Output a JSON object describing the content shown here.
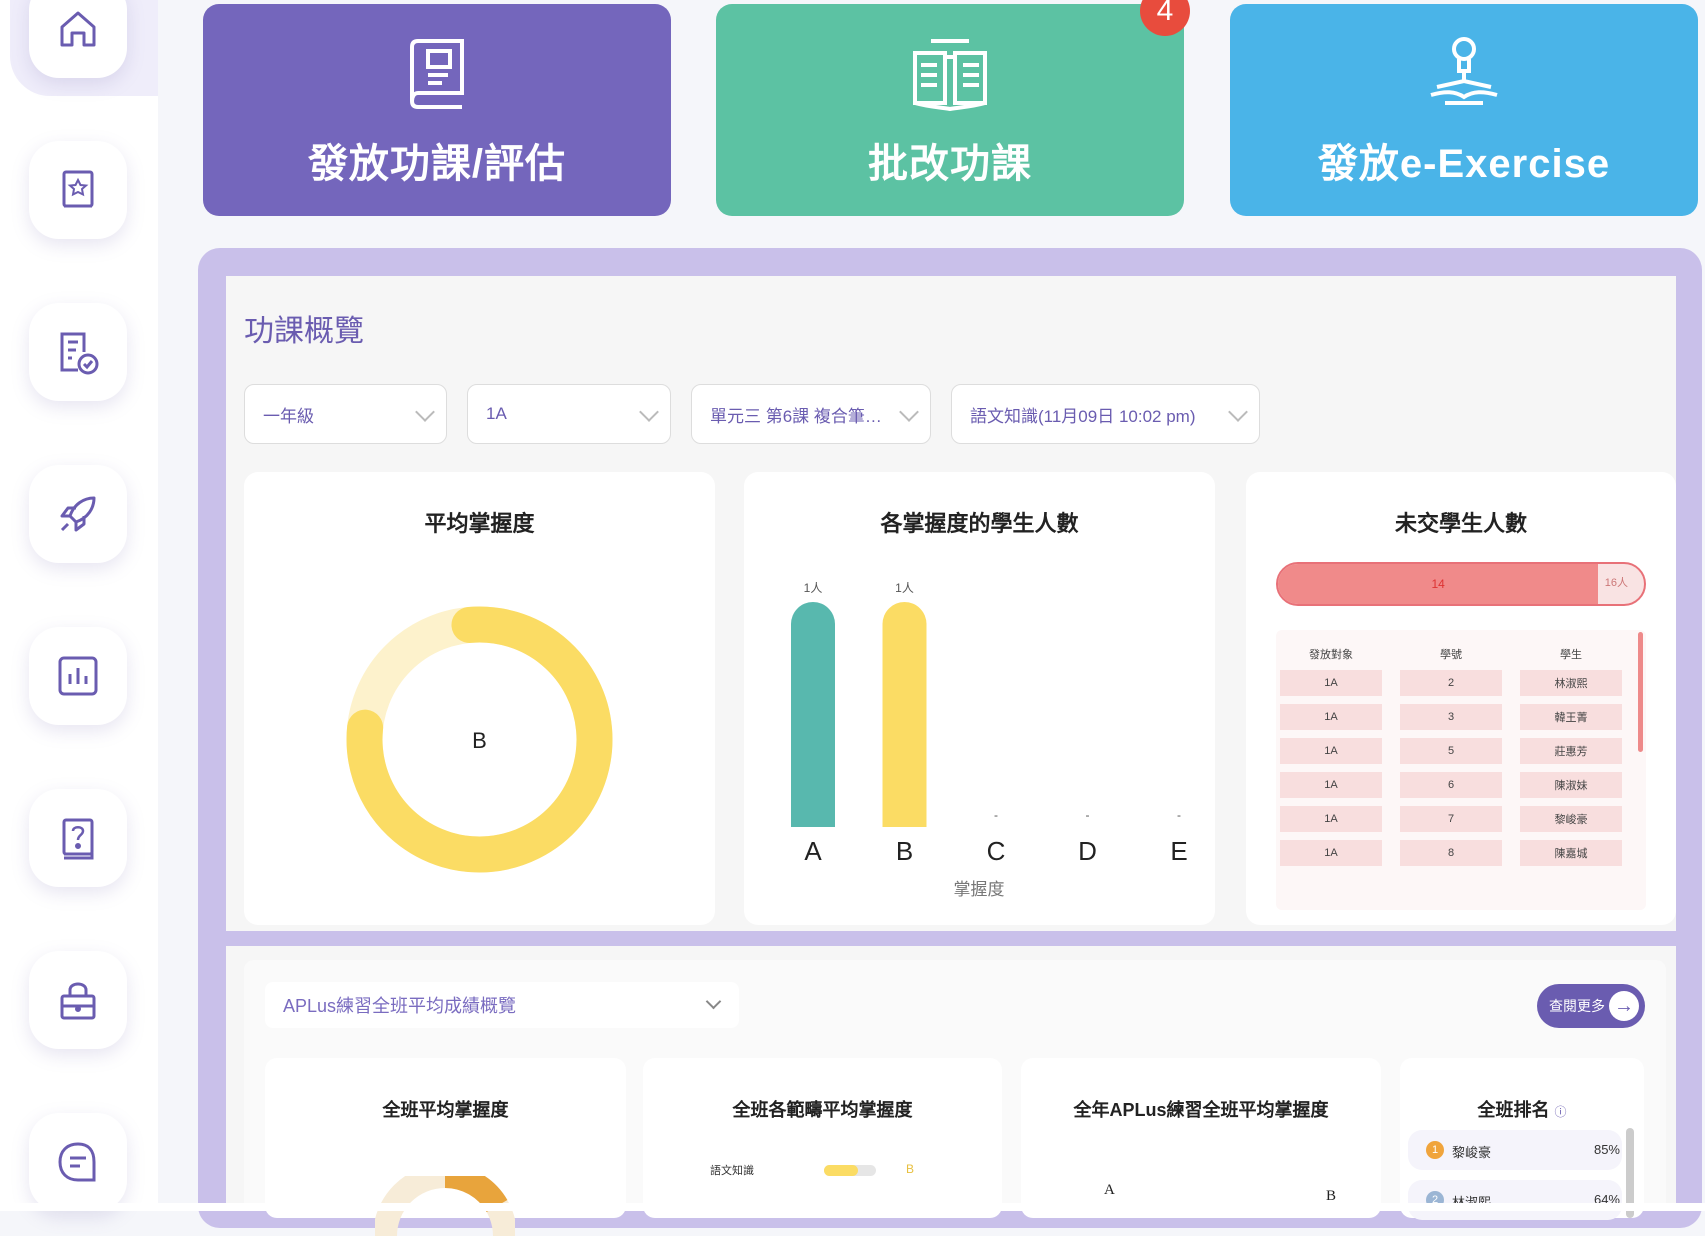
{
  "action_buttons": [
    {
      "label": "發放功課/評估",
      "color": "#7466bc",
      "icon": "notebook-icon"
    },
    {
      "label": "批改功課",
      "color": "#5cc2a3",
      "icon": "open-book-icon",
      "badge": "4"
    },
    {
      "label": "發放e-Exercise",
      "color": "#4ab4e8",
      "icon": "reading-lightbulb-icon"
    }
  ],
  "sidebar": {
    "items": [
      "home-icon",
      "star-book-icon",
      "checklist-icon",
      "rocket-icon",
      "bar-chart-icon",
      "question-book-icon",
      "lock-bag-icon",
      "chat-icon"
    ]
  },
  "overview": {
    "title": "功課概覽",
    "filters": {
      "grade": "一年級",
      "class": "1A",
      "unit": "單元三 第6課 複合筆…",
      "assignment": "語文知識(11月09日 10:02 pm)"
    }
  },
  "avg_mastery": {
    "title": "平均掌握度",
    "center_label": "B",
    "ring_fraction": 0.78,
    "ring_color": "#fbdc64",
    "track_color": "#fdf2cc"
  },
  "chart_data": {
    "type": "bar",
    "title": "各掌握度的學生人數",
    "categories": [
      "A",
      "B",
      "C",
      "D",
      "E"
    ],
    "values": [
      1,
      1,
      0,
      0,
      0
    ],
    "data_labels": [
      "1人",
      "1人",
      "-",
      "-",
      "-"
    ],
    "bar_colors": [
      "#58b8ae",
      "#fbdc64",
      "#cccccc",
      "#cccccc",
      "#cccccc"
    ],
    "xlabel": "掌握度",
    "ylabel": ""
  },
  "not_submitted": {
    "title": "未交學生人數",
    "count": "14",
    "total_label": "16人",
    "count_value": 14,
    "total_value": 16,
    "columns": [
      "發放對象",
      "學號",
      "學生"
    ],
    "rows": [
      [
        "1A",
        "2",
        "林淑熙"
      ],
      [
        "1A",
        "3",
        "韓王菁"
      ],
      [
        "1A",
        "5",
        "莊惠芳"
      ],
      [
        "1A",
        "6",
        "陳淑妹"
      ],
      [
        "1A",
        "7",
        "黎峻豪"
      ],
      [
        "1A",
        "8",
        "陳嘉城"
      ]
    ]
  },
  "aplus": {
    "selector": "APLus練習全班平均成績概覽",
    "more_button": "查閱更多",
    "cards": [
      {
        "title": "全班平均掌握度"
      },
      {
        "title": "全班各範疇平均掌握度",
        "rows": [
          {
            "label": "語文知識",
            "value": "B"
          }
        ]
      },
      {
        "title": "全年APLus練習全班平均掌握度",
        "labels": [
          "A",
          "B"
        ]
      },
      {
        "title": "全班排名",
        "ranking": [
          {
            "rank": "1",
            "name": "黎峻豪",
            "score": "85%"
          },
          {
            "rank": "2",
            "name": "林淑熙",
            "score": "64%"
          }
        ]
      }
    ]
  }
}
